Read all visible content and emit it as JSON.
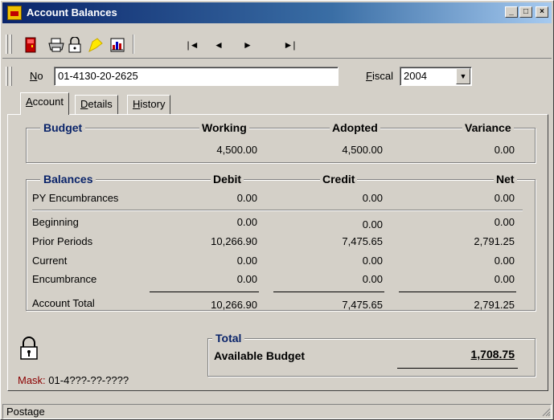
{
  "window": {
    "title": "Account Balances"
  },
  "titlebar_buttons": {
    "minimize": "_",
    "maximize": "□",
    "close": "×"
  },
  "toolbar": {
    "icons": [
      "exit-icon",
      "print-icon",
      "lock-print-icon",
      "comment-icon",
      "report-icon"
    ],
    "nav": {
      "first": "|◄",
      "prev": "◄",
      "next": "►",
      "last": "►|"
    }
  },
  "search": {
    "no_label_underline": "N",
    "no_label_rest": "o",
    "no_value": "01-4130-20-2625",
    "fiscal_label_underline": "F",
    "fiscal_label_rest": "iscal",
    "fiscal_value": "2004"
  },
  "tabs": [
    {
      "underline": "A",
      "rest": "ccount"
    },
    {
      "underline": "D",
      "rest": "etails"
    },
    {
      "underline": "H",
      "rest": "istory"
    }
  ],
  "budget": {
    "title": "Budget",
    "headers": {
      "working": "Working",
      "adopted": "Adopted",
      "variance": "Variance"
    },
    "values": {
      "working": "4,500.00",
      "adopted": "4,500.00",
      "variance": "0.00"
    }
  },
  "balances": {
    "title": "Balances",
    "headers": {
      "debit": "Debit",
      "credit": "Credit",
      "net": "Net"
    },
    "py_row": {
      "label": "PY Encumbrances",
      "debit": "0.00",
      "credit": "0.00",
      "net": "0.00"
    },
    "rows": [
      {
        "label": "Beginning",
        "debit": "0.00",
        "credit": "0.00",
        "net": "0.00"
      },
      {
        "label": "Prior Periods",
        "debit": "10,266.90",
        "credit": "7,475.65",
        "net": "2,791.25"
      },
      {
        "label": "Current",
        "debit": "0.00",
        "credit": "0.00",
        "net": "0.00"
      },
      {
        "label": "Encumbrance",
        "debit": "0.00",
        "credit": "0.00",
        "net": "0.00"
      }
    ],
    "total_row": {
      "label": "Account Total",
      "debit": "10,266.90",
      "credit": "7,475.65",
      "net": "2,791.25"
    }
  },
  "total": {
    "title": "Total",
    "label": "Available Budget",
    "value": "1,708.75"
  },
  "mask": {
    "label": "Mask:",
    "value": "01-4???-??-????"
  },
  "status": {
    "text": "Postage"
  },
  "colors": {
    "group_title": "#0a246a",
    "mask_label": "#8b0000",
    "face": "#d4d0c8"
  }
}
